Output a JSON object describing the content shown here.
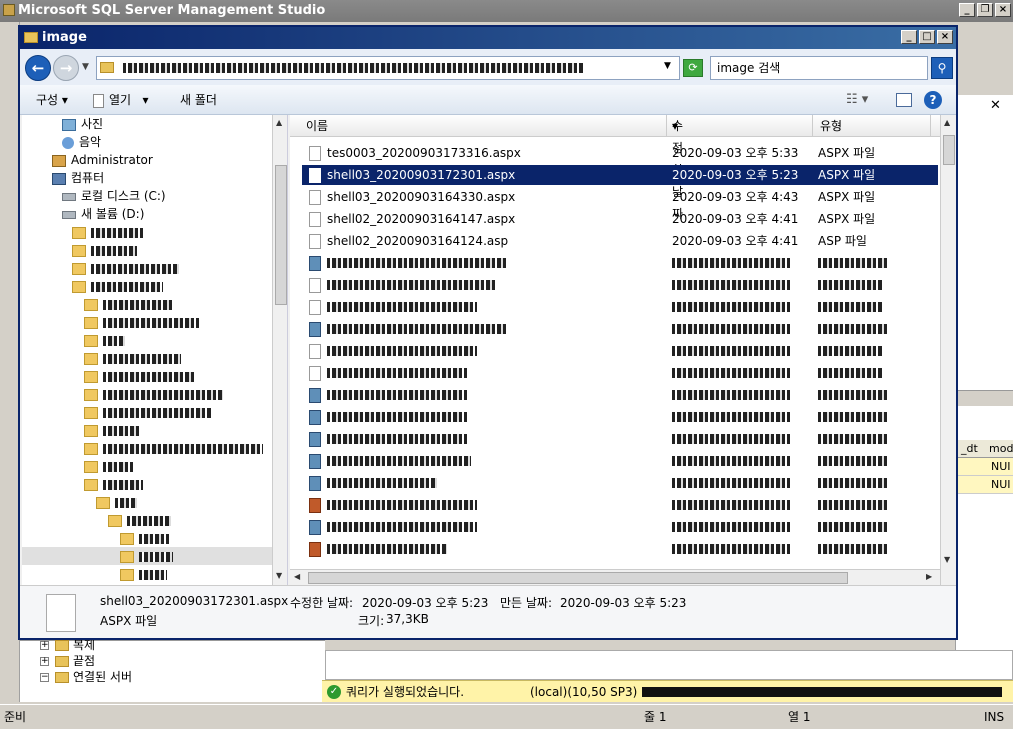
{
  "ssms": {
    "title": "Microsoft SQL Server Management Studio",
    "panel_close": "✕",
    "grid_headers": [
      "_dt",
      "mod"
    ],
    "grid_rows": [
      {
        "value": "NUI"
      },
      {
        "value": "NUI"
      }
    ],
    "tree": [
      {
        "label": "복제",
        "toggle": "+"
      },
      {
        "label": "끝점",
        "toggle": "+"
      },
      {
        "label": "연결된 서버",
        "toggle": "−"
      }
    ],
    "query_status": "쿼리가 실행되었습니다.",
    "server_info": "(local)(10,50 SP3)",
    "statusbar": {
      "ready": "준비",
      "row": "줄 1",
      "col": "열 1",
      "mode": "INS"
    }
  },
  "explorer": {
    "title": "image",
    "search_placeholder": "image 검색",
    "toolbar": {
      "organize": "구성",
      "open": "열기",
      "new_folder": "새 폴더"
    },
    "nav_items": [
      {
        "label": "사진",
        "icon": "pictures-icon",
        "indent": 40
      },
      {
        "label": "음악",
        "icon": "music-icon",
        "indent": 40
      },
      {
        "label": "Administrator",
        "icon": "user-icon",
        "indent": 30
      },
      {
        "label": "컴퓨터",
        "icon": "computer-icon",
        "indent": 30
      },
      {
        "label": "로컬 디스크 (C:)",
        "icon": "drive-icon",
        "indent": 40
      },
      {
        "label": "새 볼륨 (D:)",
        "icon": "drive-icon",
        "indent": 40
      }
    ],
    "columns": {
      "name": "이름",
      "modified": "수정한 날짜",
      "type": "유형"
    },
    "files": [
      {
        "name": "tes0003_20200903173316.aspx",
        "modified": "2020-09-03 오후 5:33",
        "type": "ASPX 파일"
      },
      {
        "name": "shell03_20200903172301.aspx",
        "modified": "2020-09-03 오후 5:23",
        "type": "ASPX 파일"
      },
      {
        "name": "shell03_20200903164330.aspx",
        "modified": "2020-09-03 오후 4:43",
        "type": "ASPX 파일"
      },
      {
        "name": "shell02_20200903164147.aspx",
        "modified": "2020-09-03 오후 4:41",
        "type": "ASPX 파일"
      },
      {
        "name": "shell02_20200903164124.asp",
        "modified": "2020-09-03 오후 4:41",
        "type": "ASP 파일"
      }
    ],
    "details": {
      "filename": "shell03_20200903172301.aspx",
      "filetype": "ASPX 파일",
      "modified_label": "수정한 날짜:",
      "modified_value": "2020-09-03 오후 5:23",
      "created_label": "만든 날짜:",
      "created_value": "2020-09-03 오후 5:23",
      "size_label": "크기:",
      "size_value": "37,3KB"
    }
  }
}
